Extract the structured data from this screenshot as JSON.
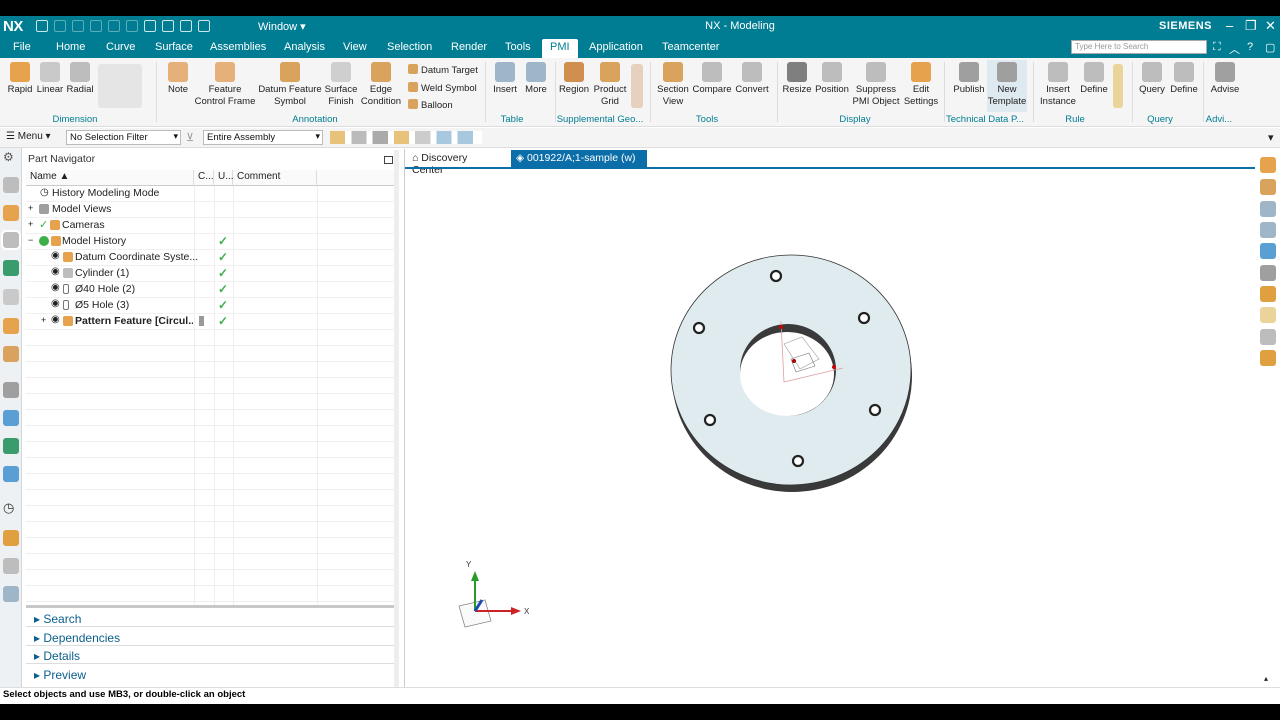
{
  "titlebar": {
    "logo": "NX",
    "window_label": "Window ▾",
    "title": "NX - Modeling",
    "brand": "SIEMENS"
  },
  "menu": {
    "items": [
      "File",
      "Home",
      "Curve",
      "Surface",
      "Assemblies",
      "Analysis",
      "View",
      "Selection",
      "Render",
      "Tools",
      "PMI",
      "Application",
      "Teamcenter"
    ],
    "active": "PMI",
    "search_placeholder": "Type Here to Search"
  },
  "ribbon": {
    "dimension": {
      "rapid": "Rapid",
      "linear": "Linear",
      "radial": "Radial",
      "group": "Dimension"
    },
    "annotation": {
      "note": "Note",
      "fcf": "Feature Control Frame",
      "dfs": "Datum Feature Symbol",
      "sf": "Surface Finish",
      "ec": "Edge Condition",
      "datum_target": "Datum Target",
      "weld": "Weld Symbol",
      "balloon": "Balloon",
      "group": "Annotation"
    },
    "table": {
      "insert": "Insert",
      "more": "More",
      "group": "Table"
    },
    "suppl": {
      "region": "Region",
      "grid": "Product Grid",
      "group": "Supplemental Geo..."
    },
    "tools": {
      "section": "Section View",
      "compare": "Compare",
      "convert": "Convert",
      "group": "Tools"
    },
    "display": {
      "resize": "Resize",
      "position": "Position",
      "suppress": "Suppress PMI Object",
      "edit": "Edit Settings",
      "group": "Display"
    },
    "tdp": {
      "publish": "Publish",
      "new_template": "New Template",
      "group": "Technical Data P..."
    },
    "rule": {
      "insert": "Insert Instance",
      "define": "Define",
      "group": "Rule"
    },
    "query": {
      "query": "Query",
      "define": "Define",
      "group": "Query"
    },
    "advise": {
      "advise": "Advise",
      "group": "Advi..."
    }
  },
  "selbar": {
    "menu": "Menu",
    "filter": "No Selection Filter",
    "scope": "Entire Assembly"
  },
  "nav": {
    "title": "Part Navigator",
    "cols": {
      "name": "Name",
      "c": "C...",
      "u": "U...",
      "comment": "Comment"
    },
    "rows": [
      {
        "label": "History Modeling Mode"
      },
      {
        "label": "Model Views"
      },
      {
        "label": "Cameras"
      },
      {
        "label": "Model History"
      },
      {
        "label": "Datum Coordinate Syste..."
      },
      {
        "label": "Cylinder (1)"
      },
      {
        "label": "Ø40 Hole (2)"
      },
      {
        "label": "Ø5 Hole (3)"
      },
      {
        "label": "Pattern Feature [Circul..."
      }
    ],
    "sections": [
      "Search",
      "Dependencies",
      "Details",
      "Preview"
    ]
  },
  "tabs": {
    "discovery": "Discovery Center",
    "part": "001922/A;1-sample (w)",
    "close": "×"
  },
  "triad": {
    "x": "X",
    "y": "Y"
  },
  "status": "Select objects and use MB3, or double-click an object"
}
